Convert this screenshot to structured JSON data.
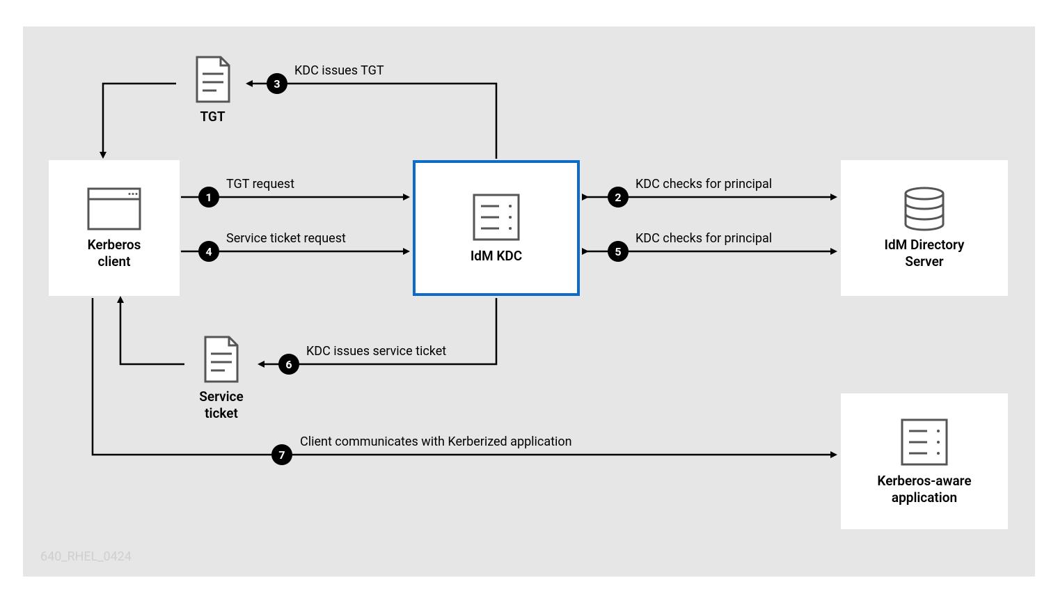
{
  "nodes": {
    "client": {
      "label": "Kerberos\nclient"
    },
    "kdc": {
      "label": "IdM KDC"
    },
    "directory": {
      "label": "IdM Directory\nServer"
    },
    "app": {
      "label": "Kerberos-aware\napplication"
    },
    "tgt": {
      "label": "TGT"
    },
    "service_ticket": {
      "label": "Service\nticket"
    }
  },
  "steps": {
    "s1": {
      "num": "1",
      "label": "TGT request"
    },
    "s2": {
      "num": "2",
      "label": "KDC checks for principal"
    },
    "s3": {
      "num": "3",
      "label": "KDC issues TGT"
    },
    "s4": {
      "num": "4",
      "label": "Service ticket request"
    },
    "s5": {
      "num": "5",
      "label": "KDC checks for principal"
    },
    "s6": {
      "num": "6",
      "label": "KDC issues service ticket"
    },
    "s7": {
      "num": "7",
      "label": "Client communicates with Kerberized application"
    }
  },
  "footer": "640_RHEL_0424",
  "colors": {
    "highlight": "#0d6cc7"
  }
}
